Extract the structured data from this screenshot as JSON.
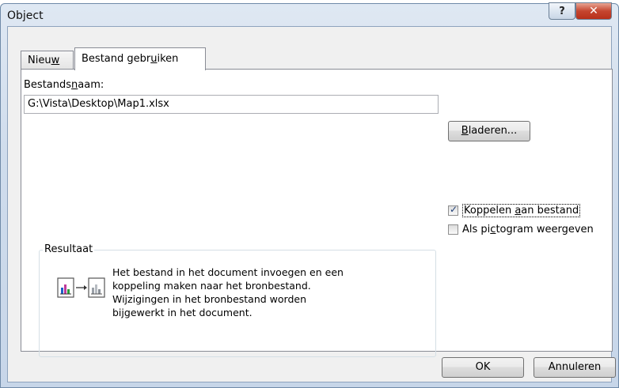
{
  "window": {
    "title": "Object",
    "help_label": "?",
    "close_label": "✕"
  },
  "tabs": [
    {
      "label_pre": "Nieu",
      "label_u": "w",
      "label_post": "",
      "active": false
    },
    {
      "label_pre": "Bestand gebr",
      "label_u": "u",
      "label_post": "iken",
      "active": true
    }
  ],
  "filename": {
    "label_pre": "Bestands",
    "label_u": "n",
    "label_post": "aam:",
    "value": "G:\\Vista\\Desktop\\Map1.xlsx"
  },
  "browse_button": {
    "label_u": "B",
    "label_post": "laderen..."
  },
  "options": {
    "link": {
      "label_pre": "Koppelen ",
      "label_u": "a",
      "label_post": "an bestand",
      "checked": true
    },
    "icon": {
      "label_pre": "Als pi",
      "label_u": "c",
      "label_post": "togram weergeven",
      "checked": false
    }
  },
  "result": {
    "title": "Resultaat",
    "lines": [
      "Het bestand in het document invoegen en een",
      "koppeling maken naar het bronbestand.",
      "Wijzigingen in het bronbestand worden",
      "bijgewerkt in het document."
    ]
  },
  "footer": {
    "ok_label": "OK",
    "cancel_label": "Annuleren"
  }
}
